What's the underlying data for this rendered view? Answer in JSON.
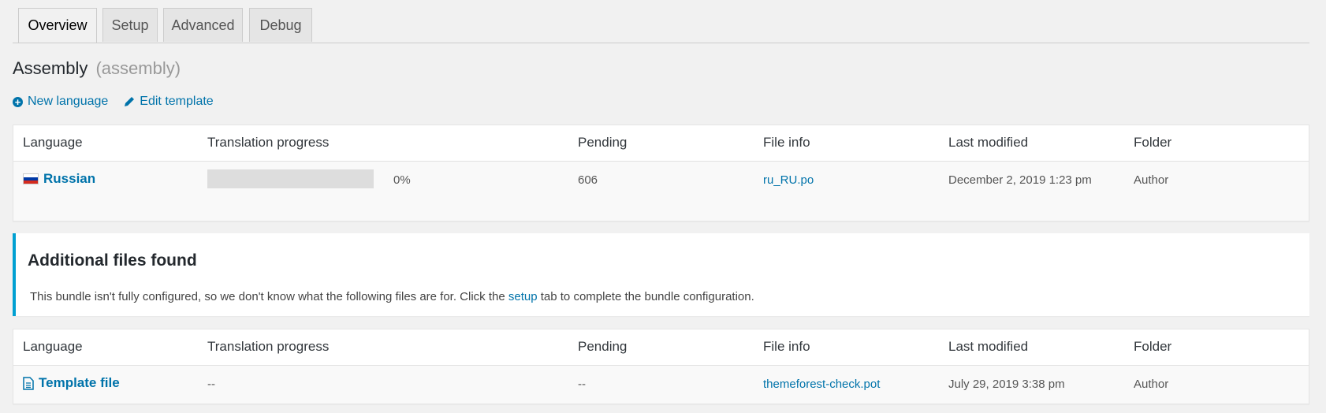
{
  "tabs": [
    {
      "label": "Overview",
      "active": true
    },
    {
      "label": "Setup",
      "active": false
    },
    {
      "label": "Advanced",
      "active": false
    },
    {
      "label": "Debug",
      "active": false
    }
  ],
  "heading": {
    "title": "Assembly",
    "slug": "(assembly)"
  },
  "actions": {
    "new_language": "New language",
    "edit_template": "Edit template"
  },
  "columns": [
    "Language",
    "Translation progress",
    "Pending",
    "File info",
    "Last modified",
    "Folder"
  ],
  "languages_table": {
    "rows": [
      {
        "language": "Russian",
        "flag": "russia-flag-icon",
        "progress_percent": 0,
        "progress_label": "0%",
        "pending": "606",
        "file": "ru_RU.po",
        "modified": "December 2, 2019 1:23 pm",
        "folder": "Author"
      }
    ]
  },
  "notice": {
    "title": "Additional files found",
    "text_before": "This bundle isn't fully configured, so we don't know what the following files are for. Click the",
    "link": "setup",
    "text_after": "tab to complete the bundle configuration."
  },
  "extra_table": {
    "rows": [
      {
        "language": "Template file",
        "icon": "document-icon",
        "progress": "--",
        "pending": "--",
        "file": "themeforest-check.pot",
        "modified": "July 29, 2019 3:38 pm",
        "folder": "Author"
      }
    ]
  },
  "colors": {
    "link": "#0073aa",
    "notice_border": "#00a0d2",
    "background": "#f1f1f1",
    "progress_track": "#dddddd"
  }
}
